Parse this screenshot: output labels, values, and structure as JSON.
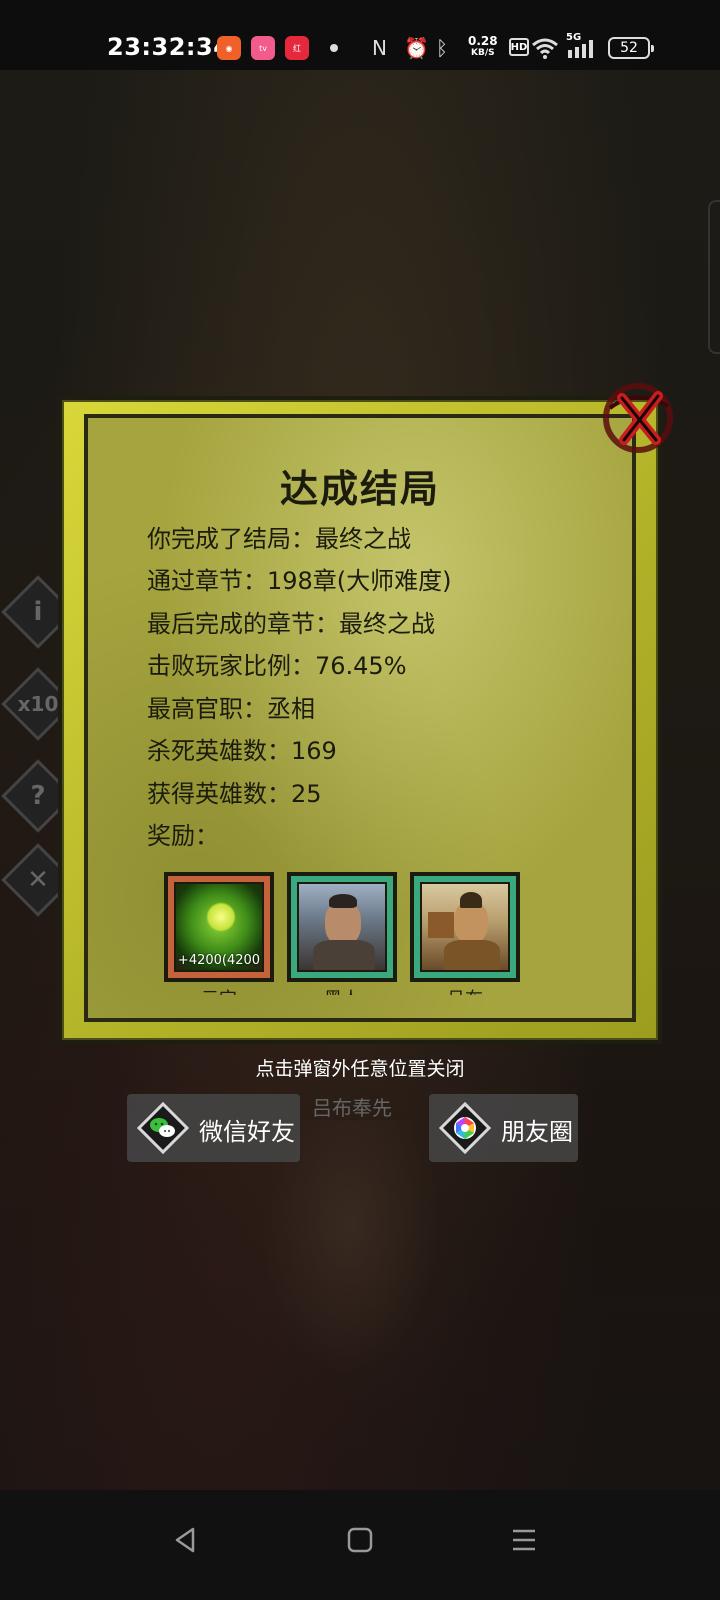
{
  "status_bar": {
    "time": "23:32:34",
    "net_speed_value": "0.28",
    "net_speed_unit": "KB/S",
    "hd": "HD",
    "signal_label": "5G",
    "battery": "52"
  },
  "dialog": {
    "title": "达成结局",
    "lines": [
      "你完成了结局：最终之战",
      "通过章节：198章(大师难度)",
      "最后完成的章节：最终之战",
      "击败玩家比例：76.45%",
      "最高官职：丞相",
      "杀死英雄数：169",
      "获得英雄数：25",
      "奖励："
    ],
    "rewards": [
      {
        "amount": "+4200(4200",
        "name": "元宝",
        "frame": "orange",
        "icon": "jade-orb-icon"
      },
      {
        "amount": "",
        "name": "黑人",
        "frame": "teal",
        "icon": "hero-portrait"
      },
      {
        "amount": "",
        "name": "吕布",
        "frame": "teal",
        "icon": "hero-portrait"
      }
    ]
  },
  "hint": "点击弹窗外任意位置关闭",
  "background_name": "吕布奉先",
  "share": {
    "wechat_label": "微信好友",
    "moments_label": "朋友圈"
  },
  "side_buttons": {
    "info": "i",
    "speed": "x10",
    "help": "?",
    "close": "✕"
  },
  "colors": {
    "panel": "#a5a43e",
    "frame_orange": "#c4623c",
    "frame_teal": "#3aa980"
  }
}
